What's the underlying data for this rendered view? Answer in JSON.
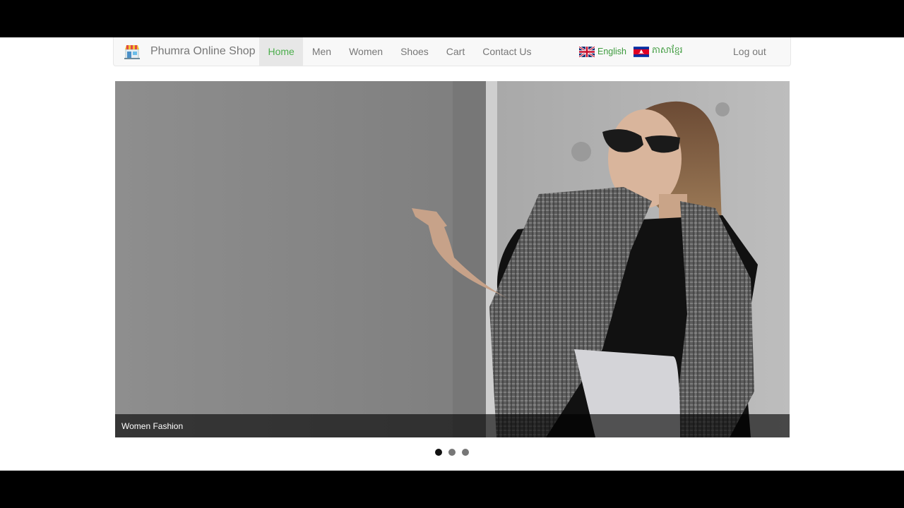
{
  "brand": {
    "name": "Phumra Online Shop",
    "icon": "shop-storefront-icon"
  },
  "nav": {
    "items": [
      {
        "label": "Home",
        "active": true
      },
      {
        "label": "Men",
        "active": false
      },
      {
        "label": "Women",
        "active": false
      },
      {
        "label": "Shoes",
        "active": false
      },
      {
        "label": "Cart",
        "active": false
      },
      {
        "label": "Contact Us",
        "active": false
      }
    ]
  },
  "language": {
    "options": [
      {
        "label": "English",
        "flag": "uk-flag-icon"
      },
      {
        "label": "ភាសាខ្មែរ",
        "flag": "cambodia-flag-icon"
      }
    ]
  },
  "account": {
    "logout_label": "Log out"
  },
  "carousel": {
    "caption": "Women Fashion",
    "slide_count": 3,
    "active_index": 0
  },
  "colors": {
    "active_link": "#4cae4c",
    "nav_background": "#f8f8f8",
    "link": "#777777"
  }
}
